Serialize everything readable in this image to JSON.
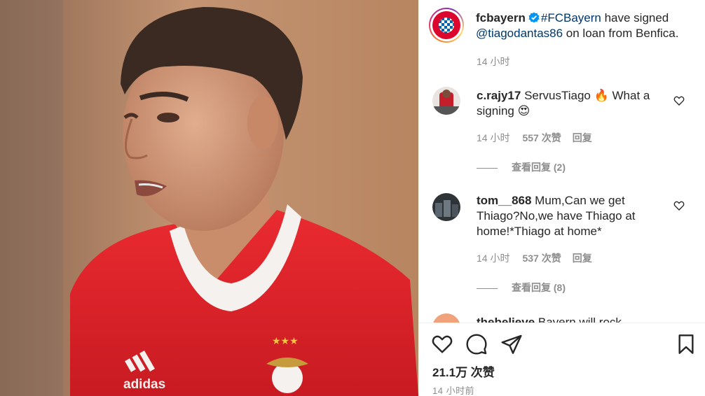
{
  "post": {
    "image_description_icon": "player-photo",
    "author": "fcbayern",
    "caption_hashtag": "#FCBayern",
    "caption_text_1": " have signed",
    "caption_mention": "@tiagodantas86",
    "caption_text_2": " on loan from Benfica.",
    "caption_time": "14 小时"
  },
  "comments": [
    {
      "user": "c.rajy17",
      "text": "ServusTiago 🔥 What a signing 😍",
      "time": "14 小时",
      "likes": "557 次赞",
      "reply": "回复",
      "view_replies": "查看回复 (2)"
    },
    {
      "user": "tom__868",
      "text": "Mum,Can we get Thiago?No,we have Thiago at home!*Thiago at home*",
      "time": "14 小时",
      "likes": "537 次赞",
      "reply": "回复",
      "view_replies": "查看回复 (8)"
    },
    {
      "user": "thebelieve",
      "text": "Bayern will rock"
    }
  ],
  "footer": {
    "likes": "21.1万 次赞",
    "time_ago": "14 小时前"
  },
  "colors": {
    "link": "#00376b",
    "muted": "#8e8e8e",
    "verified": "#0095f6",
    "jersey": "#e4222a"
  }
}
